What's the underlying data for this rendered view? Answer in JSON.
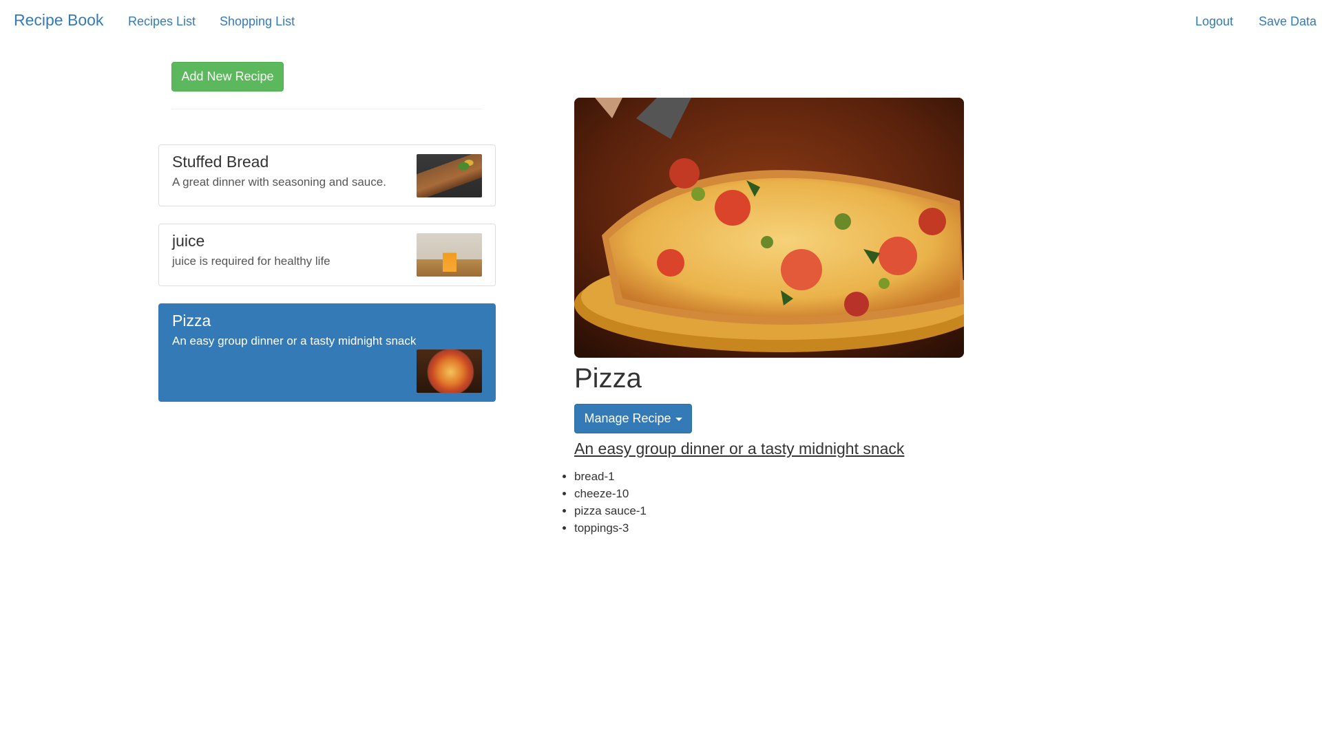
{
  "navbar": {
    "brand": "Recipe Book",
    "links": [
      "Recipes List",
      "Shopping List"
    ],
    "right_links": [
      "Logout",
      "Save Data"
    ]
  },
  "sidebar": {
    "add_button_label": "Add New Recipe",
    "recipes": [
      {
        "name": "Stuffed Bread",
        "description": "A great dinner with seasoning and sauce.",
        "thumbnail": "stuffed-bread-photo",
        "active": false
      },
      {
        "name": "juice",
        "description": "juice is required for healthy life",
        "thumbnail": "juice-photo",
        "active": false
      },
      {
        "name": "Pizza",
        "description": "An easy group dinner or a tasty midnight snack",
        "thumbnail": "pizza-photo",
        "active": true
      }
    ]
  },
  "detail": {
    "image": "pizza-photo",
    "title": "Pizza",
    "manage_button_label": "Manage Recipe",
    "description": "An easy group dinner or a tasty midnight snack",
    "ingredients": [
      "bread-1",
      "cheeze-10",
      "pizza sauce-1",
      "toppings-3"
    ]
  },
  "colors": {
    "primary": "#337ab7",
    "success": "#5cb85c",
    "text": "#333333",
    "border": "#dddddd"
  }
}
